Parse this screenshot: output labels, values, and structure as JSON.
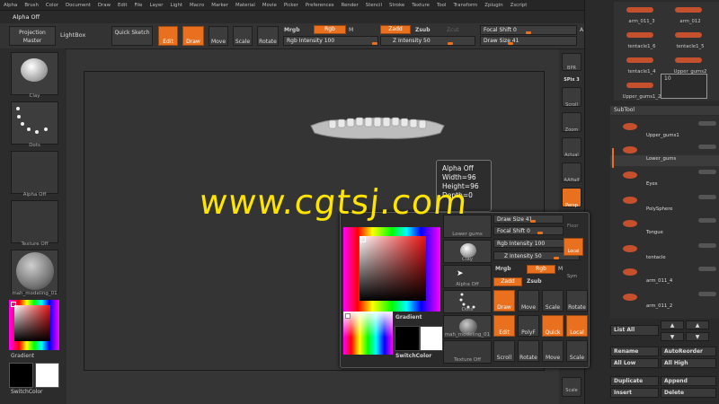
{
  "menu": [
    "Alpha",
    "Brush",
    "Color",
    "Document",
    "Draw",
    "Edit",
    "File",
    "Layer",
    "Light",
    "Macro",
    "Marker",
    "Material",
    "Movie",
    "Picker",
    "Preferences",
    "Render",
    "Stencil",
    "Stroke",
    "Texture",
    "Tool",
    "Transform",
    "Zplugin",
    "Zscript"
  ],
  "title": "Alpha Off",
  "top_shelf": {
    "projection_master": "Projection Master",
    "lightbox": "LightBox",
    "quick_sketch": "Quick Sketch",
    "edit": "Edit",
    "draw": "Draw",
    "move": "Move",
    "scale": "Scale",
    "rotate": "Rotate",
    "mrgb": "Mrgb",
    "rgb": "Rgb",
    "m": "M",
    "rgb_intensity": "Rgb Intensity 100",
    "zadd": "Zadd",
    "zsub": "Zsub",
    "zcut": "Zcut",
    "z_intensity": "Z Intensity 50",
    "focal_shift": "Focal Shift 0",
    "draw_size": "Draw Size 41",
    "a": "A"
  },
  "left_panel": {
    "brush_label": "Clay",
    "stroke_label": "Dots",
    "alpha_label": "Alpha Off",
    "texture_label": "Texture Off",
    "material_label": "mah_modeling_01",
    "gradient": "Gradient",
    "switch_color": "SwitchColor"
  },
  "right_shelf": {
    "bpr": "BPR",
    "spix": "SPix 3",
    "scroll": "Scroll",
    "zoom": "Zoom",
    "actual": "Actual",
    "aahalf": "AAHalf",
    "persp": "Persp",
    "floor": "Floor",
    "local": "Local",
    "scale": "Scale"
  },
  "tooltip": {
    "line1": "Alpha Off",
    "line2": "Width=96",
    "line3": "Height=96",
    "line4": "Depth=0"
  },
  "popup": {
    "lower_gums": "Lower gums",
    "clay": "Clay",
    "alpha_off": "Alpha Off",
    "dots": "Dots",
    "material": "mah_modeling_01",
    "texture_off": "Texture Off",
    "gradient": "Gradient",
    "switch_color": "SwitchColor",
    "draw_size": "Draw Size 41",
    "focal_shift": "Focal Shift 0",
    "rgb_intensity": "Rgb Intensity 100",
    "z_intensity": "Z Intensity 50",
    "mrgb": "Mrgb",
    "rgb": "Rgb",
    "m": "M",
    "zadd": "Zadd",
    "zsub": "Zsub",
    "draw": "Draw",
    "move": "Move",
    "scale": "Scale",
    "rotate": "Rotate",
    "edit": "Edit",
    "polyf": "PolyF",
    "quick": "Quick",
    "local": "Local",
    "scroll": "Scroll",
    "move2": "Move",
    "local_top": "Local",
    "floor": "Floor",
    "sym": "Sym"
  },
  "tool_palette": {
    "items": [
      "arm_011_3",
      "arm_012",
      "tentacle1_6",
      "tentacle1_5",
      "tentacle1_4",
      "Upper_gums2",
      "Upper_gums1_2",
      "Upper_gums1_1"
    ],
    "count": "10"
  },
  "subtool": {
    "header": "SubTool",
    "items": [
      "Upper_gums1",
      "Lower_gums",
      "Eyes",
      "PolySphere",
      "Tongue",
      "tentacle",
      "arm_011_4",
      "arm_011_2"
    ],
    "list_all": "List All",
    "rename": "Rename",
    "auto_reorder": "AutoReorder",
    "all_low": "All Low",
    "all_high": "All High",
    "duplicate": "Duplicate",
    "append": "Append",
    "insert": "Insert",
    "delete": "Delete"
  },
  "watermark": "www.cgtsj.com",
  "colors": {
    "accent": "#e8701f",
    "watermark": "#ffe400"
  }
}
